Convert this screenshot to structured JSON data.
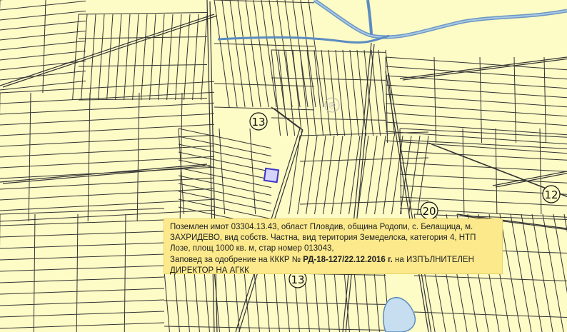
{
  "map": {
    "background_color": "#fdfbc6",
    "line_color": "#333333",
    "water_color": "#7fa9c9",
    "lake_fill": "#c7def0",
    "highlight_color": "#3b36c9",
    "watermark": "®",
    "markers": [
      {
        "id": "13a",
        "label": "13"
      },
      {
        "id": "20",
        "label": "20"
      },
      {
        "id": "12",
        "label": "12"
      },
      {
        "id": "13b",
        "label": "13"
      }
    ]
  },
  "info": {
    "line1": "Поземлен имот 03304.13.43, област Пловдив, община Родопи, с. Белащица, м.",
    "line2": "ЗАХРИДЕВО, вид собств. Частна, вид територия Земеделска, категория 4, НТП",
    "line3": "Лозе, площ 1000 кв. м, стар номер 013043,",
    "line4_prefix": "Заповед за одобрение на КККР № ",
    "line4_bold": "РД-18-127/22.12.2016 г.",
    "line4_suffix": " на ИЗПЪЛНИТЕЛЕН",
    "line5": "ДИРЕКТОР НА АГКК"
  }
}
